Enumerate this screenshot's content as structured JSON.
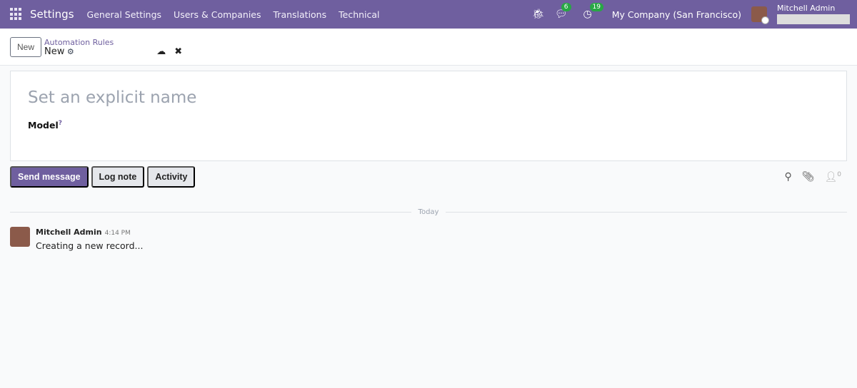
{
  "navbar": {
    "app": "Settings",
    "menus": [
      "General Settings",
      "Users & Companies",
      "Translations",
      "Technical"
    ],
    "messages_count": "6",
    "activities_count": "19",
    "company": "My Company (San Francisco)",
    "user": "Mitchell Admin"
  },
  "control_panel": {
    "new_label": "New",
    "breadcrumb_parent": "Automation Rules",
    "breadcrumb_current": "New"
  },
  "form": {
    "name_placeholder": "Set an explicit name",
    "model_label": "Model",
    "model_help": "?"
  },
  "chatter": {
    "send_message": "Send message",
    "log_note": "Log note",
    "activity": "Activity",
    "followers_count": "0",
    "date_separator": "Today",
    "messages": [
      {
        "author": "Mitchell Admin",
        "time": "4:14 PM",
        "body": "Creating a new record..."
      }
    ]
  }
}
